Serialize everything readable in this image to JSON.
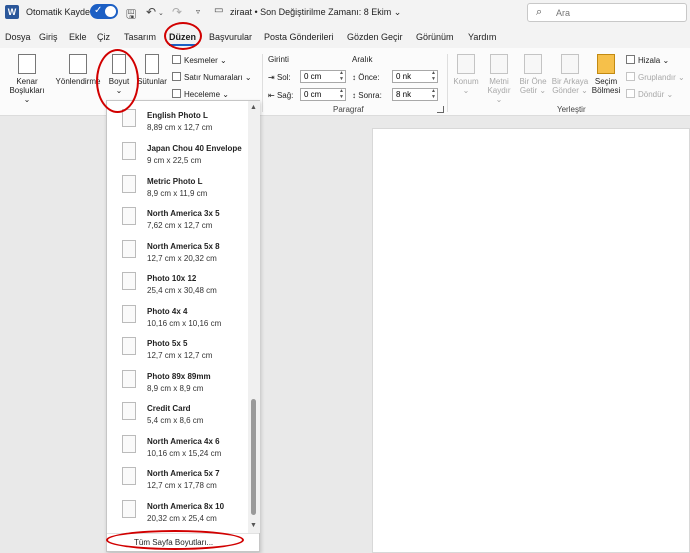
{
  "titlebar": {
    "app_icon_letter": "W",
    "autosave_label": "Otomatik Kaydet",
    "doc_title": "ziraat • Son Değiştirilme Zamanı: 8 Ekim ⌄",
    "search_placeholder": "Ara"
  },
  "menu": {
    "tabs": [
      {
        "label": "Dosya"
      },
      {
        "label": "Giriş"
      },
      {
        "label": "Ekle"
      },
      {
        "label": "Çiz"
      },
      {
        "label": "Tasarım"
      },
      {
        "label": "Düzen",
        "active": true
      },
      {
        "label": "Başvurular"
      },
      {
        "label": "Posta Gönderileri"
      },
      {
        "label": "Gözden Geçir"
      },
      {
        "label": "Görünüm"
      },
      {
        "label": "Yardım"
      }
    ]
  },
  "ribbon": {
    "margins_label_1": "Kenar",
    "margins_label_2": "Boşlukları ⌄",
    "orientation_label": "Yönlendirme",
    "size_label": "Boyut",
    "size_chevron": "⌄",
    "columns_label": "Sütunlar",
    "breaks_label": "Kesmeler ⌄",
    "line_numbers_label": "Satır Numaraları ⌄",
    "hyphenation_label": "Heceleme ⌄",
    "indent_title": "Girinti",
    "indent_left_label": "Sol:",
    "indent_left_value": "0 cm",
    "indent_right_label": "Sağ:",
    "indent_right_value": "0 cm",
    "spacing_title": "Aralık",
    "spacing_before_label": "Önce:",
    "spacing_before_value": "0 nk",
    "spacing_after_label": "Sonra:",
    "spacing_after_value": "8 nk",
    "paragraph_group": "Paragraf",
    "position_label": "Konum",
    "position_chevron": "⌄",
    "wrap_text_1": "Metni",
    "wrap_text_2": "Kaydır ⌄",
    "bring_forward_1": "Bir Öne",
    "bring_forward_2": "Getir ⌄",
    "send_backward_1": "Bir Arkaya",
    "send_backward_2": "Gönder ⌄",
    "selection_pane_1": "Seçim",
    "selection_pane_2": "Bölmesi",
    "align_label": "Hizala ⌄",
    "group_label": "Gruplandır ⌄",
    "rotate_label": "Döndür ⌄",
    "arrange_group": "Yerleştir"
  },
  "size_dropdown": {
    "items": [
      {
        "name": "English Photo L",
        "dims": "8,89 cm x 12,7 cm"
      },
      {
        "name": "Japan Chou 40 Envelope",
        "dims": "9 cm x 22,5 cm"
      },
      {
        "name": "Metric Photo L",
        "dims": "8,9 cm x 11,9 cm"
      },
      {
        "name": "North America 3x 5",
        "dims": "7,62 cm x 12,7 cm"
      },
      {
        "name": "North America 5x 8",
        "dims": "12,7 cm x 20,32 cm"
      },
      {
        "name": "Photo 10x 12",
        "dims": "25,4 cm x 30,48 cm"
      },
      {
        "name": "Photo 4x 4",
        "dims": "10,16 cm x 10,16 cm"
      },
      {
        "name": "Photo 5x 5",
        "dims": "12,7 cm x 12,7 cm"
      },
      {
        "name": "Photo 89x 89mm",
        "dims": "8,9 cm x 8,9 cm"
      },
      {
        "name": "Credit Card",
        "dims": "5,4 cm x 8,6 cm"
      },
      {
        "name": "North America 4x 6",
        "dims": "10,16 cm x 15,24 cm"
      },
      {
        "name": "North America 5x 7",
        "dims": "12,7 cm x 17,78 cm"
      },
      {
        "name": "North America 8x 10",
        "dims": "20,32 cm x 25,4 cm"
      }
    ],
    "more_sizes_label": "Tüm Sayfa Boyutları..."
  },
  "colors": {
    "accent": "#1c5fc4",
    "annotation": "#d10000"
  }
}
